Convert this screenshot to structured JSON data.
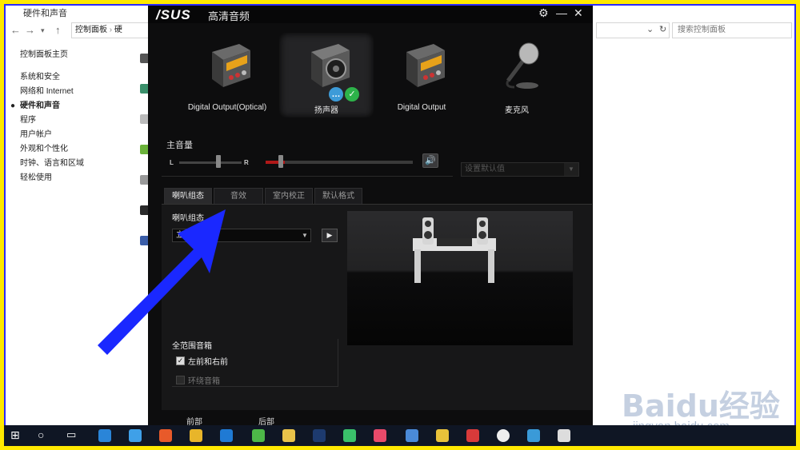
{
  "explorer": {
    "title": "硬件和声音",
    "breadcrumb": "控制面板",
    "breadcrumb_next": "硬",
    "search_placeholder": "搜索控制面板",
    "sidebar": {
      "home": "控制面板主页",
      "items": [
        {
          "label": "系统和安全",
          "active": false
        },
        {
          "label": "网络和 Internet",
          "active": false
        },
        {
          "label": "硬件和声音",
          "active": true
        },
        {
          "label": "程序",
          "active": false
        },
        {
          "label": "用户帐户",
          "active": false
        },
        {
          "label": "外观和个性化",
          "active": false
        },
        {
          "label": "时钟、语言和区域",
          "active": false
        },
        {
          "label": "轻松使用",
          "active": false
        }
      ]
    }
  },
  "asus": {
    "logo": "/SUS",
    "app_name": "高清音频",
    "devices": [
      {
        "label": "Digital Output(Optical)",
        "icon": "digital-output-icon",
        "active": false
      },
      {
        "label": "扬声器",
        "icon": "speaker-icon",
        "active": true
      },
      {
        "label": "Digital Output",
        "icon": "digital-output-icon",
        "active": false
      },
      {
        "label": "麦克风",
        "icon": "microphone-icon",
        "active": false
      }
    ],
    "volume": {
      "title": "主音量",
      "left_label": "L",
      "right_label": "R",
      "level": 0.13,
      "balance": 0.6
    },
    "default_device_label": "设置默认值",
    "tabs": [
      "喇叭组态",
      "音效",
      "室内校正",
      "默认格式"
    ],
    "active_tab": 0,
    "config": {
      "title": "喇叭组态",
      "selected": "立体声",
      "full_range_title": "全范围音箱",
      "options": [
        {
          "label": "左前和右前",
          "checked": true,
          "enabled": true
        },
        {
          "label": "环绕音箱",
          "checked": false,
          "enabled": false
        }
      ]
    },
    "jacks": {
      "front_label": "前部",
      "back_label": "后部"
    }
  },
  "watermark": {
    "brand": "Baidu经验",
    "url": "jingyan.baidu.com"
  },
  "colors": {
    "frame": "#ffe900",
    "border": "#2a2aff",
    "arrow": "#1a28ff",
    "volume_fill": "#b01818",
    "check_green": "#2db34a"
  }
}
